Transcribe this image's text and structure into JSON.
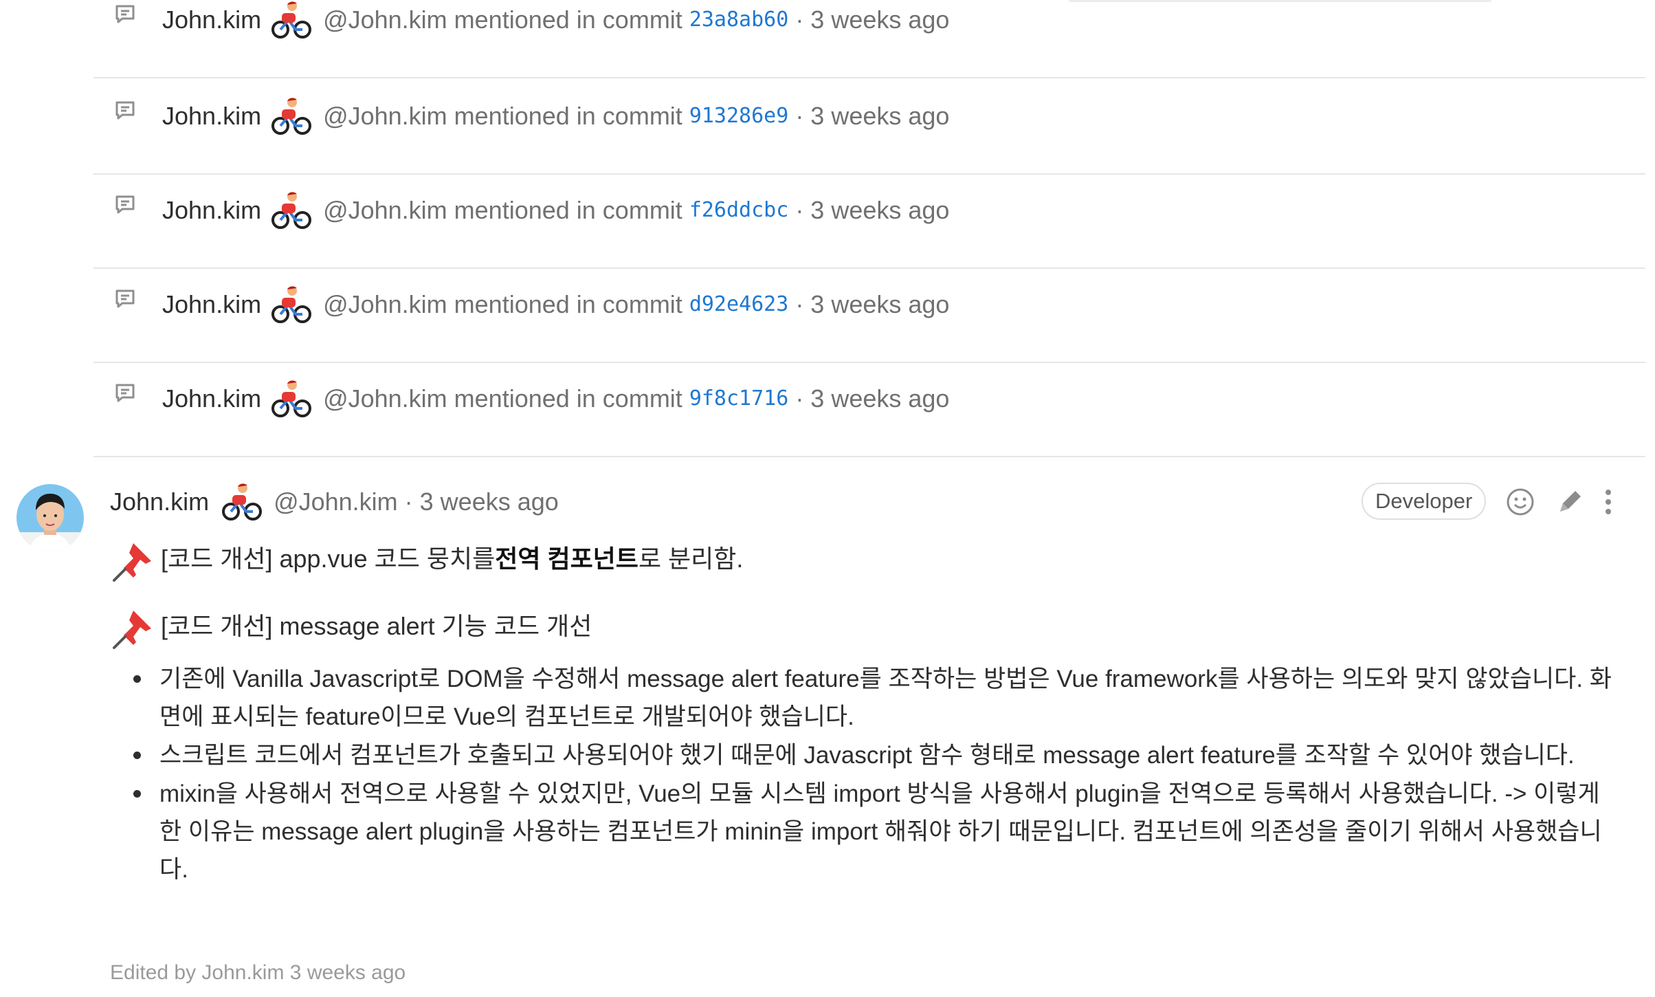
{
  "system_notes": [
    {
      "author": "John.kim",
      "text": "@John.kim mentioned in commit",
      "sha": "23a8ab60",
      "time": "· 3 weeks ago"
    },
    {
      "author": "John.kim",
      "text": "@John.kim mentioned in commit",
      "sha": "913286e9",
      "time": "· 3 weeks ago"
    },
    {
      "author": "John.kim",
      "text": "@John.kim mentioned in commit",
      "sha": "f26ddcbc",
      "time": "· 3 weeks ago"
    },
    {
      "author": "John.kim",
      "text": "@John.kim mentioned in commit",
      "sha": "d92e4623",
      "time": "· 3 weeks ago"
    },
    {
      "author": "John.kim",
      "text": "@John.kim mentioned in commit",
      "sha": "9f8c1716",
      "time": "· 3 weeks ago"
    }
  ],
  "comment": {
    "author": "John.kim",
    "handle": "@John.kim",
    "time": "· 3 weeks ago",
    "role": "Developer",
    "pins": [
      {
        "before": "[코드 개선] app.vue 코드 뭉치를 ",
        "bold": "전역 컴포넌트",
        "after": "로 분리함."
      },
      {
        "before": "[코드 개선] message alert 기능 코드 개선",
        "bold": "",
        "after": ""
      }
    ],
    "bullets": [
      "기존에 Vanilla Javascript로 DOM을 수정해서 message alert feature를 조작하는 방법은 Vue framework를 사용하는 의도와 맞지 않았습니다. 화면에 표시되는 feature이므로 Vue의 컴포넌트로 개발되어야 했습니다.",
      "스크립트 코드에서 컴포넌트가 호출되고 사용되어야 했기 때문에 Javascript 함수 형태로 message alert feature를 조작할 수 있어야 했습니다.",
      "mixin을 사용해서 전역으로 사용할 수 있었지만, Vue의 모듈 시스템 import 방식을 사용해서 plugin을 전역으로 등록해서 사용했습니다. -> 이렇게 한 이유는 message alert plugin을 사용하는 컴포넌트가 minin을 import 해줘야 하기 때문입니다. 컴포넌트에 의존성을 줄이기 위해서 사용했습니다."
    ],
    "edited": "Edited by John.kim 3 weeks ago"
  },
  "icons": {
    "note": "comment-note-icon",
    "status_emoji": "person-biking-emoji",
    "pin": "pushpin-emoji",
    "actions": [
      "smiley-icon",
      "pencil-icon",
      "kebab-menu-icon"
    ]
  },
  "colors": {
    "link": "#1f78d1",
    "muted": "#707070",
    "divider": "#e6e6e6"
  }
}
